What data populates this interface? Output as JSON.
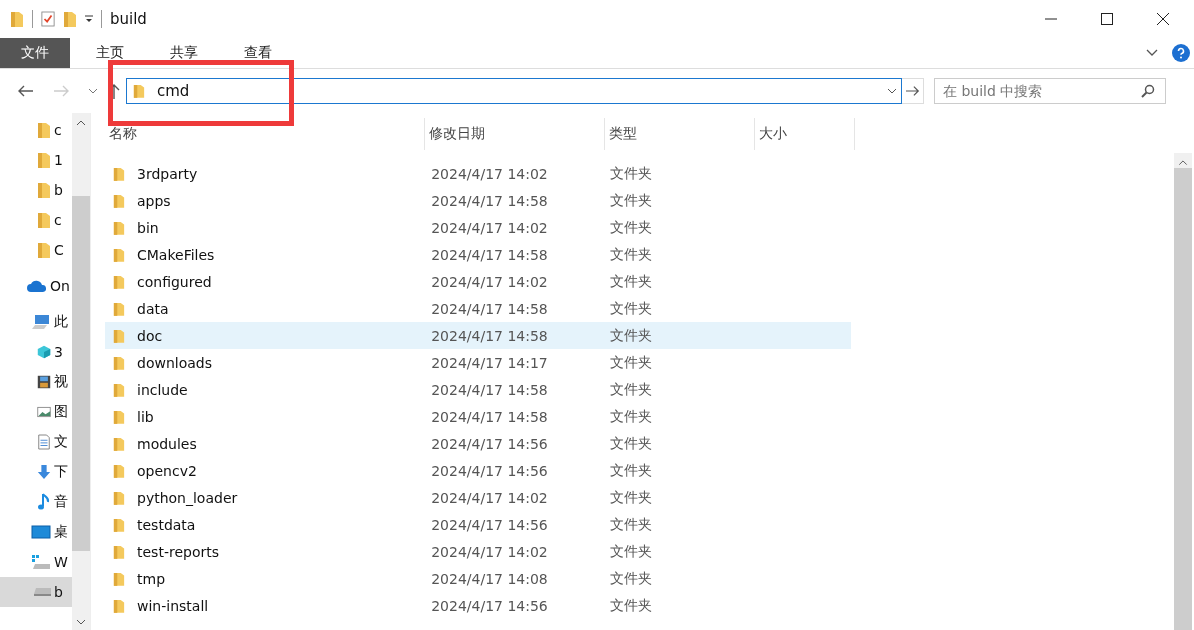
{
  "window": {
    "title": "build"
  },
  "ribbon_tabs": [
    {
      "label": "文件",
      "selected": true
    },
    {
      "label": "主页",
      "selected": false
    },
    {
      "label": "共享",
      "selected": false
    },
    {
      "label": "查看",
      "selected": false
    }
  ],
  "address": {
    "value": "cmd"
  },
  "search": {
    "placeholder": "在 build 中搜索"
  },
  "nav_items": [
    {
      "kind": "folder",
      "label": "c",
      "selected": false
    },
    {
      "kind": "folder",
      "label": "1",
      "selected": false
    },
    {
      "kind": "folder",
      "label": "b",
      "selected": false
    },
    {
      "kind": "folder",
      "label": "c",
      "selected": false
    },
    {
      "kind": "folder",
      "label": "C",
      "selected": false
    },
    {
      "kind": "cloud",
      "label": "On",
      "selected": false
    },
    {
      "kind": "pc",
      "label": "此",
      "selected": false
    },
    {
      "kind": "cube",
      "label": "3",
      "selected": false
    },
    {
      "kind": "film",
      "label": "视",
      "selected": false
    },
    {
      "kind": "image",
      "label": "图",
      "selected": false
    },
    {
      "kind": "doc",
      "label": "文",
      "selected": false
    },
    {
      "kind": "download",
      "label": "下",
      "selected": false
    },
    {
      "kind": "music",
      "label": "音",
      "selected": false
    },
    {
      "kind": "desktop",
      "label": "桌",
      "selected": false
    },
    {
      "kind": "windrive",
      "label": "W",
      "selected": false
    },
    {
      "kind": "drive",
      "label": "b",
      "selected": true
    }
  ],
  "columns": [
    "名称",
    "修改日期",
    "类型",
    "大小"
  ],
  "files": [
    {
      "kind": "folder",
      "name": "3rdparty",
      "date": "2024/4/17 14:02",
      "type": "文件夹",
      "selected": false
    },
    {
      "kind": "folder",
      "name": "apps",
      "date": "2024/4/17 14:58",
      "type": "文件夹",
      "selected": false
    },
    {
      "kind": "folder",
      "name": "bin",
      "date": "2024/4/17 14:02",
      "type": "文件夹",
      "selected": false
    },
    {
      "kind": "folder",
      "name": "CMakeFiles",
      "date": "2024/4/17 14:58",
      "type": "文件夹",
      "selected": false
    },
    {
      "kind": "folder",
      "name": "configured",
      "date": "2024/4/17 14:02",
      "type": "文件夹",
      "selected": false
    },
    {
      "kind": "folder",
      "name": "data",
      "date": "2024/4/17 14:58",
      "type": "文件夹",
      "selected": false
    },
    {
      "kind": "folder",
      "name": "doc",
      "date": "2024/4/17 14:58",
      "type": "文件夹",
      "selected": true
    },
    {
      "kind": "folder",
      "name": "downloads",
      "date": "2024/4/17 14:17",
      "type": "文件夹",
      "selected": false
    },
    {
      "kind": "folder",
      "name": "include",
      "date": "2024/4/17 14:58",
      "type": "文件夹",
      "selected": false
    },
    {
      "kind": "folder",
      "name": "lib",
      "date": "2024/4/17 14:58",
      "type": "文件夹",
      "selected": false
    },
    {
      "kind": "folder",
      "name": "modules",
      "date": "2024/4/17 14:56",
      "type": "文件夹",
      "selected": false
    },
    {
      "kind": "folder",
      "name": "opencv2",
      "date": "2024/4/17 14:56",
      "type": "文件夹",
      "selected": false
    },
    {
      "kind": "folder",
      "name": "python_loader",
      "date": "2024/4/17 14:02",
      "type": "文件夹",
      "selected": false
    },
    {
      "kind": "folder",
      "name": "testdata",
      "date": "2024/4/17 14:56",
      "type": "文件夹",
      "selected": false
    },
    {
      "kind": "folder",
      "name": "test-reports",
      "date": "2024/4/17 14:02",
      "type": "文件夹",
      "selected": false
    },
    {
      "kind": "folder",
      "name": "tmp",
      "date": "2024/4/17 14:08",
      "type": "文件夹",
      "selected": false
    },
    {
      "kind": "folder",
      "name": "win-install",
      "date": "2024/4/17 14:56",
      "type": "文件夹",
      "selected": false
    }
  ]
}
